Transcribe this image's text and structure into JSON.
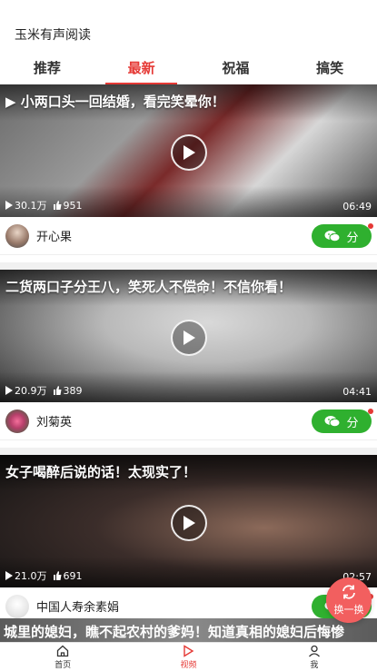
{
  "app": {
    "title": "玉米有声阅读"
  },
  "tabs": [
    {
      "label": "推荐",
      "active": false
    },
    {
      "label": "最新",
      "active": true
    },
    {
      "label": "祝福",
      "active": false
    },
    {
      "label": "搞笑",
      "active": false
    }
  ],
  "cards": [
    {
      "title": "▶ 小两口头一回结婚，看完笑晕你！",
      "views": "30.1万",
      "likes": "951",
      "duration": "06:49",
      "author": "开心果",
      "share_label": "分"
    },
    {
      "title": "二货两口子分王八，笑死人不偿命！不信你看！",
      "views": "20.9万",
      "likes": "389",
      "duration": "04:41",
      "author": "刘菊英",
      "share_label": "分"
    },
    {
      "title": "女子喝醉后说的话！太现实了！",
      "views": "21.0万",
      "likes": "691",
      "duration": "02:57",
      "author": "中国人寿余素娟",
      "share_label": "分"
    }
  ],
  "partial": {
    "title": "城里的媳妇，瞧不起农村的爹妈！知道真相的媳妇后悔惨"
  },
  "fab": {
    "label": "换一换",
    "icon": "refresh-icon"
  },
  "bottom_nav": [
    {
      "label": "首页",
      "icon": "home-icon",
      "active": false
    },
    {
      "label": "视频",
      "icon": "play-icon",
      "active": true
    },
    {
      "label": "我",
      "icon": "user-icon",
      "active": false
    }
  ],
  "colors": {
    "accent": "#e53935",
    "share_green": "#2fb02f",
    "fab": "#f25f5f"
  }
}
